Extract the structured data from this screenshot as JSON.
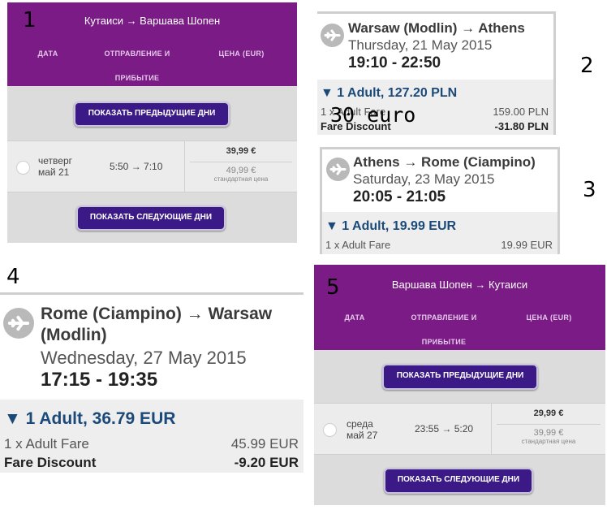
{
  "labels": {
    "n1": "1",
    "n2": "2",
    "n3": "3",
    "n4": "4",
    "n5": "5",
    "note": "30 euro"
  },
  "wizz1": {
    "title": "Кутаиси → Варшава Шопен",
    "col_date": "ДАТА",
    "col_depart": "ОТПРАВЛЕНИЕ И",
    "col_arrive": "ПРИБЫТИЕ",
    "col_price": "ЦЕНА (EUR)",
    "prev_button": "ПОКАЗАТЬ ПРЕДЫДУЩИЕ ДНИ",
    "next_button": "ПОКАЗАТЬ СЛЕДУЮЩИЕ ДНИ",
    "weekday": "четверг",
    "day": "май 21",
    "times": "5:50 → 7:10",
    "price": "39,99 €",
    "standard_price": "49,99 €",
    "standard_label": "стандартная цена"
  },
  "wizz5": {
    "title": "Варшава Шопен → Кутаиси",
    "col_date": "ДАТА",
    "col_depart": "ОТПРАВЛЕНИЕ И",
    "col_arrive": "ПРИБЫТИЕ",
    "col_price": "ЦЕНА (EUR)",
    "prev_button": "ПОКАЗАТЬ ПРЕДЫДУЩИЕ ДНИ",
    "next_button": "ПОКАЗАТЬ СЛЕДУЮЩИЕ ДНИ",
    "weekday": "среда",
    "day": "май 27",
    "times": "23:55 → 5:20",
    "price": "29,99 €",
    "standard_price": "39,99 €",
    "standard_label": "стандартная цена"
  },
  "ryan2": {
    "route": "Warsaw (Modlin) → Athens",
    "date": "Thursday, 21 May 2015",
    "time": "19:10 - 22:50",
    "adult": "▼ 1 Adult, 127.20 PLN",
    "fare_label": "1 x Adult Fare",
    "fare_amount": "159.00 PLN",
    "discount_label": "Fare Discount",
    "discount_amount": "-31.80 PLN"
  },
  "ryan3": {
    "route": "Athens → Rome (Ciampino)",
    "date": "Saturday, 23 May 2015",
    "time": "20:05 - 21:05",
    "adult": "▼ 1 Adult, 19.99 EUR",
    "fare_label": "1 x Adult Fare",
    "fare_amount": "19.99 EUR"
  },
  "ryan4": {
    "route_line1": "Rome (Ciampino) → Warsaw",
    "route_line2": "(Modlin)",
    "date": "Wednesday, 27 May 2015",
    "time": "17:15 - 19:35",
    "adult": "▼ 1 Adult, 36.79 EUR",
    "fare_label": "1 x Adult Fare",
    "fare_amount": "45.99 EUR",
    "discount_label": "Fare Discount",
    "discount_amount": "-9.20 EUR"
  },
  "icons": {
    "plane": "airplane-icon",
    "radio": "radio-button"
  },
  "colors": {
    "wizz_purple": "#7a1b86",
    "wizz_button": "#3b1a88",
    "ryan_blue": "#1b4a7a"
  }
}
